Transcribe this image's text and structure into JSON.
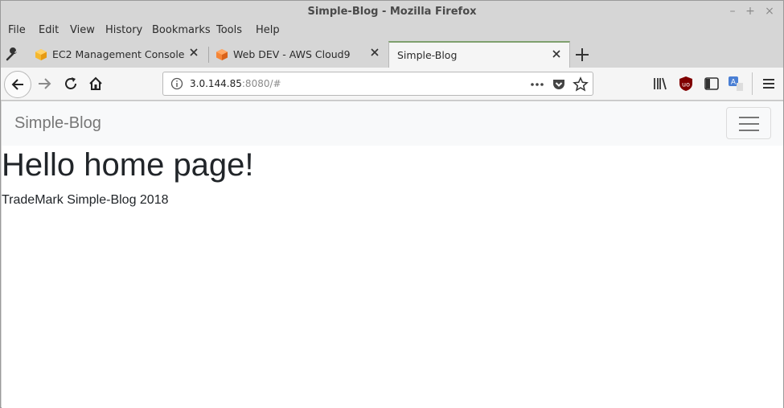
{
  "window": {
    "title": "Simple-Blog - Mozilla Firefox"
  },
  "menu": [
    "File",
    "Edit",
    "View",
    "History",
    "Bookmarks",
    "Tools",
    "Help"
  ],
  "tabs": [
    {
      "label": "EC2 Management Console",
      "icon": "aws-cube-icon"
    },
    {
      "label": "Web DEV - AWS Cloud9",
      "icon": "cloud9-icon"
    },
    {
      "label": "Simple-Blog",
      "active": true
    }
  ],
  "urlbar": {
    "host": "3.0.144.85",
    "rest": ":8080/#"
  },
  "site": {
    "brand": "Simple-Blog",
    "heading": "Hello home page!",
    "footer": "TradeMark Simple-Blog 2018"
  },
  "colors": {
    "active_tab_accent": "#7fa06e",
    "ublock_red": "#800000",
    "translate_blue": "#4a7fd4"
  }
}
